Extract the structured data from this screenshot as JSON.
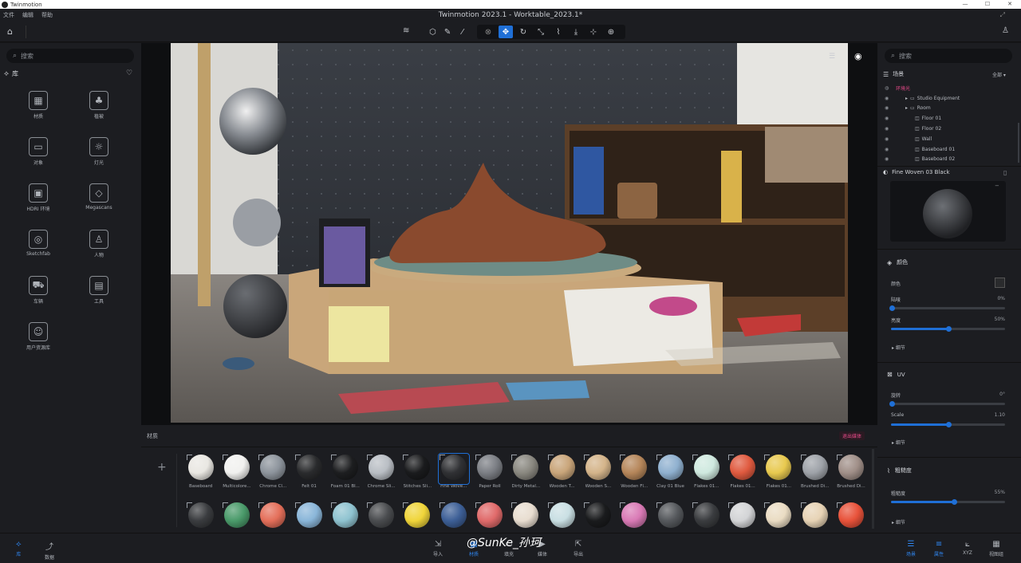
{
  "window": {
    "app_name": "Twinmotion",
    "title": "Twinmotion 2023.1 - Worktable_2023.1*",
    "controls": [
      "—",
      "☐",
      "✕"
    ]
  },
  "menu": [
    "文件",
    "编辑",
    "帮助"
  ],
  "toolbar": {
    "home_icon": "home-icon",
    "user_icon": "user-icon"
  },
  "library": {
    "search_placeholder": "搜索",
    "title": "库",
    "items": [
      {
        "label": "材质",
        "icon": "materials-icon"
      },
      {
        "label": "植被",
        "icon": "vegetation-icon"
      },
      {
        "label": "对象",
        "icon": "objects-icon"
      },
      {
        "label": "灯光",
        "icon": "lights-icon"
      },
      {
        "label": "HDRI 环境",
        "icon": "hdri-icon"
      },
      {
        "label": "Megascans",
        "icon": "megascans-icon"
      },
      {
        "label": "Sketchfab",
        "icon": "sketchfab-icon"
      },
      {
        "label": "人物",
        "icon": "people-icon"
      },
      {
        "label": "车辆",
        "icon": "vehicles-icon"
      },
      {
        "label": "工具",
        "icon": "tools-icon"
      },
      {
        "label": "用户资源库",
        "icon": "user-library-icon"
      }
    ]
  },
  "scene_panel": {
    "search_placeholder": "搜索",
    "title": "场景",
    "filter": "全部",
    "tree": [
      {
        "label": "环境光",
        "level": 0,
        "highlight": true
      },
      {
        "label": "Studio Equipment",
        "level": 1
      },
      {
        "label": "Room",
        "level": 1
      },
      {
        "label": "Floor 01",
        "level": 2
      },
      {
        "label": "Floor 02",
        "level": 2
      },
      {
        "label": "Wall",
        "level": 2
      },
      {
        "label": "Baseboard 01",
        "level": 2
      },
      {
        "label": "Baseboard 02",
        "level": 2
      }
    ]
  },
  "material_props": {
    "name": "Fine Woven 03 Black",
    "color_section": "颜色",
    "color_label": "颜色",
    "weathering_label": "陆唛",
    "weathering_value": "0%",
    "brightness_label": "亮度",
    "brightness_value": "50%",
    "detail_label": "细节",
    "uv_section": "UV",
    "rotation_label": "旋转",
    "rotation_value": "0°",
    "scale_label": "Scale",
    "scale_value": "1.10",
    "uv_detail_label": "细节",
    "roughness_section": "粗糙度",
    "roughness_label": "粗糙度",
    "roughness_value": "55%",
    "roughness_detail_label": "细节",
    "brightness_fraction": 0.5,
    "scale_fraction": 0.5,
    "roughness_fraction": 0.55
  },
  "material_bar": {
    "title": "材质",
    "exit_label": "退出媒体",
    "add_label": "+",
    "row1": [
      {
        "label": "Baseboard",
        "color": "#e9e7e2"
      },
      {
        "label": "Multicolore...",
        "color": "#f1f1ef"
      },
      {
        "label": "Chrome Cl...",
        "color": "#8d949c"
      },
      {
        "label": "Felt 01",
        "color": "#2a2b2d"
      },
      {
        "label": "Foam 01 Bl...",
        "color": "#1d1e20"
      },
      {
        "label": "Chrome Sli...",
        "color": "#b9bec4"
      },
      {
        "label": "Stitches Sli...",
        "color": "#1a1b1d"
      },
      {
        "label": "Fine Wove...",
        "color": "#303134",
        "selected": true
      },
      {
        "label": "Paper Roll",
        "color": "#7b7e84"
      },
      {
        "label": "Dirty Metal...",
        "color": "#8a8880"
      },
      {
        "label": "Wooden T...",
        "color": "#c9a57a"
      },
      {
        "label": "Wooden S...",
        "color": "#d4b48a"
      },
      {
        "label": "Wooden Fl...",
        "color": "#b5865a"
      },
      {
        "label": "Clay 01 Blue",
        "color": "#8fb0cf"
      },
      {
        "label": "Flakes 01...",
        "color": "#cfe9df"
      },
      {
        "label": "Flakes 01...",
        "color": "#e05a3f"
      },
      {
        "label": "Flakes 01...",
        "color": "#e8c94f"
      },
      {
        "label": "Brushed Di...",
        "color": "#9ea2a8"
      },
      {
        "label": "Brushed Di...",
        "color": "#a08f88"
      }
    ],
    "row2": [
      {
        "label": "",
        "color": "#3a3c3f"
      },
      {
        "label": "",
        "color": "#4a9a6a"
      },
      {
        "label": "",
        "color": "#e46f5a"
      },
      {
        "label": "",
        "color": "#8ab6d9"
      },
      {
        "label": "",
        "color": "#8fc3d0"
      },
      {
        "label": "",
        "color": "#4a4c4f"
      },
      {
        "label": "",
        "color": "#f0d53a"
      },
      {
        "label": "",
        "color": "#3d5f96"
      },
      {
        "label": "",
        "color": "#e06a6a"
      },
      {
        "label": "",
        "color": "#e8ddd0"
      },
      {
        "label": "",
        "color": "#c9dfe3"
      },
      {
        "label": "",
        "color": "#1a1b1d"
      },
      {
        "label": "",
        "color": "#d97ab5"
      },
      {
        "label": "",
        "color": "#55585c"
      },
      {
        "label": "",
        "color": "#3a3c3f"
      },
      {
        "label": "",
        "color": "#d3d4d6"
      },
      {
        "label": "",
        "color": "#eadcc3"
      },
      {
        "label": "",
        "color": "#e7d3b5"
      },
      {
        "label": "",
        "color": "#e8523a"
      }
    ]
  },
  "status": {
    "left": [
      {
        "label": "库",
        "icon": "library-icon",
        "active": true
      },
      {
        "label": "数据",
        "icon": "data-icon"
      }
    ],
    "center": [
      {
        "label": "导入",
        "icon": "import-icon"
      },
      {
        "label": "材质",
        "icon": "materials-icon",
        "active": true
      },
      {
        "label": "填充",
        "icon": "fill-icon"
      },
      {
        "label": "媒体",
        "icon": "media-icon"
      },
      {
        "label": "导出",
        "icon": "export-icon"
      }
    ],
    "right": [
      {
        "label": "场景",
        "icon": "scene-icon",
        "active": true
      },
      {
        "label": "属性",
        "icon": "properties-icon",
        "active": true
      },
      {
        "label": "XYZ",
        "icon": "xyz-icon"
      },
      {
        "label": "视图组",
        "icon": "views-icon"
      }
    ]
  },
  "watermark": "@SunKe_孙珂",
  "colors": {
    "accent": "#1f6fd6",
    "panel": "#1c1d21",
    "dark": "#16171a",
    "highlight": "#e94a8a"
  }
}
